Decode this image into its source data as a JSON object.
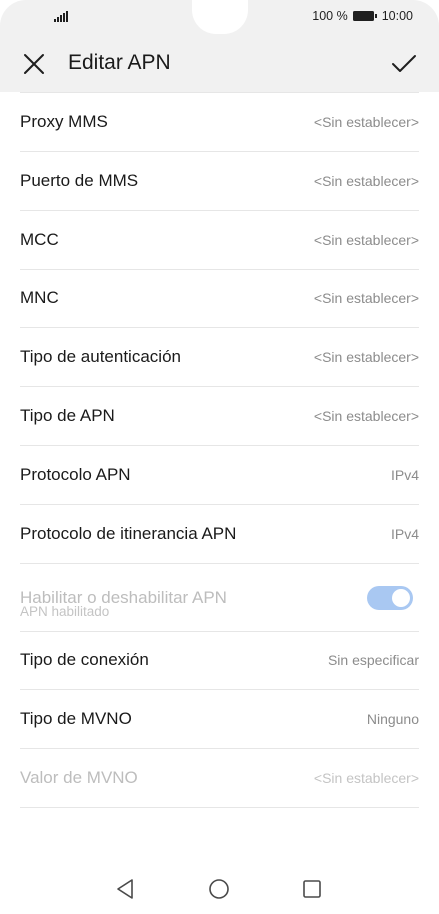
{
  "status_bar": {
    "battery_percent": "100 %",
    "time": "10:00",
    "icons": [
      "signal-icon",
      "battery-icon"
    ]
  },
  "app_bar": {
    "title": "Editar APN",
    "close_icon": "close-icon",
    "confirm_icon": "check-icon"
  },
  "settings": [
    {
      "label": "Proxy MMS",
      "value": "<Sin establecer>",
      "enabled": true
    },
    {
      "label": "Puerto de MMS",
      "value": "<Sin establecer>",
      "enabled": true
    },
    {
      "label": "MCC",
      "value": "<Sin establecer>",
      "enabled": true
    },
    {
      "label": "MNC",
      "value": "<Sin establecer>",
      "enabled": true
    },
    {
      "label": "Tipo de autenticación",
      "value": "<Sin establecer>",
      "enabled": true
    },
    {
      "label": "Tipo de APN",
      "value": "<Sin establecer>",
      "enabled": true
    },
    {
      "label": "Protocolo APN",
      "value": "IPv4",
      "enabled": true
    },
    {
      "label": "Protocolo de itinerancia APN",
      "value": "IPv4",
      "enabled": true
    }
  ],
  "apn_toggle": {
    "label": "Habilitar o deshabilitar APN",
    "sublabel": "APN habilitado",
    "state": "on",
    "enabled": false,
    "accent": "#a9c8f2"
  },
  "settings_after": [
    {
      "label": "Tipo de conexión",
      "value": "Sin especificar",
      "enabled": true
    },
    {
      "label": "Tipo de MVNO",
      "value": "Ninguno",
      "enabled": true
    },
    {
      "label": "Valor de MVNO",
      "value": "<Sin establecer>",
      "enabled": false
    }
  ],
  "nav_bar": {
    "icons": [
      "back-triangle-icon",
      "home-circle-icon",
      "recent-square-icon"
    ]
  }
}
